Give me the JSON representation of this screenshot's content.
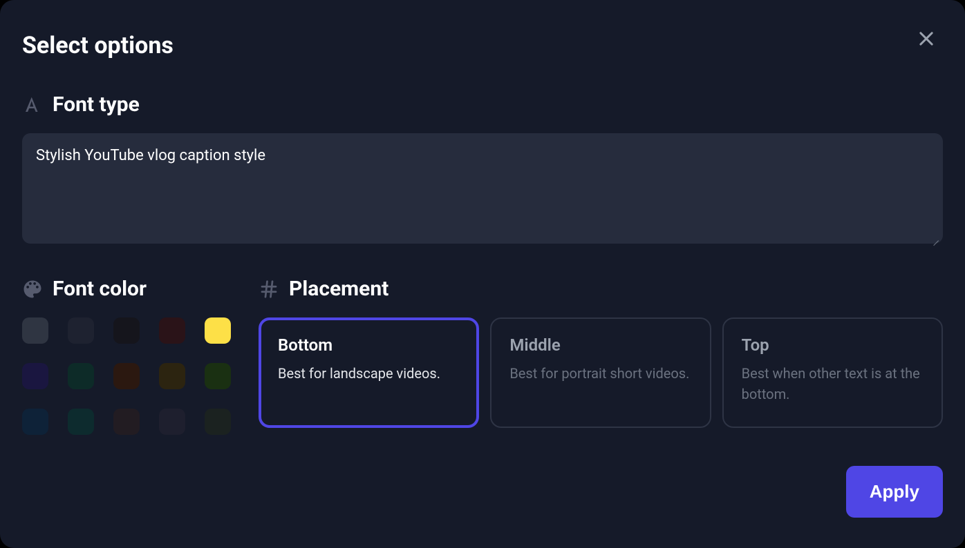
{
  "title": "Select options",
  "fontType": {
    "label": "Font type",
    "value": "Stylish YouTube vlog caption style"
  },
  "fontColor": {
    "label": "Font color",
    "swatches": [
      {
        "color": "#2F3542",
        "selected": false
      },
      {
        "color": "#1E2230",
        "selected": false
      },
      {
        "color": "#15151C",
        "selected": false
      },
      {
        "color": "#2A1318",
        "selected": false
      },
      {
        "color": "#FDE047",
        "selected": true
      },
      {
        "color": "#1A1640",
        "selected": false
      },
      {
        "color": "#0D2B28",
        "selected": false
      },
      {
        "color": "#2B1810",
        "selected": false
      },
      {
        "color": "#2C2410",
        "selected": false
      },
      {
        "color": "#1A3012",
        "selected": false
      },
      {
        "color": "#0E2238",
        "selected": false
      },
      {
        "color": "#0D2B2E",
        "selected": false
      },
      {
        "color": "#221C22",
        "selected": false
      },
      {
        "color": "#1E1F2E",
        "selected": false
      },
      {
        "color": "#1B2220",
        "selected": false
      }
    ]
  },
  "placement": {
    "label": "Placement",
    "options": [
      {
        "title": "Bottom",
        "desc": "Best for landscape videos.",
        "selected": true
      },
      {
        "title": "Middle",
        "desc": "Best for portrait short videos.",
        "selected": false
      },
      {
        "title": "Top",
        "desc": "Best when other text is at the bottom.",
        "selected": false
      }
    ]
  },
  "applyLabel": "Apply"
}
